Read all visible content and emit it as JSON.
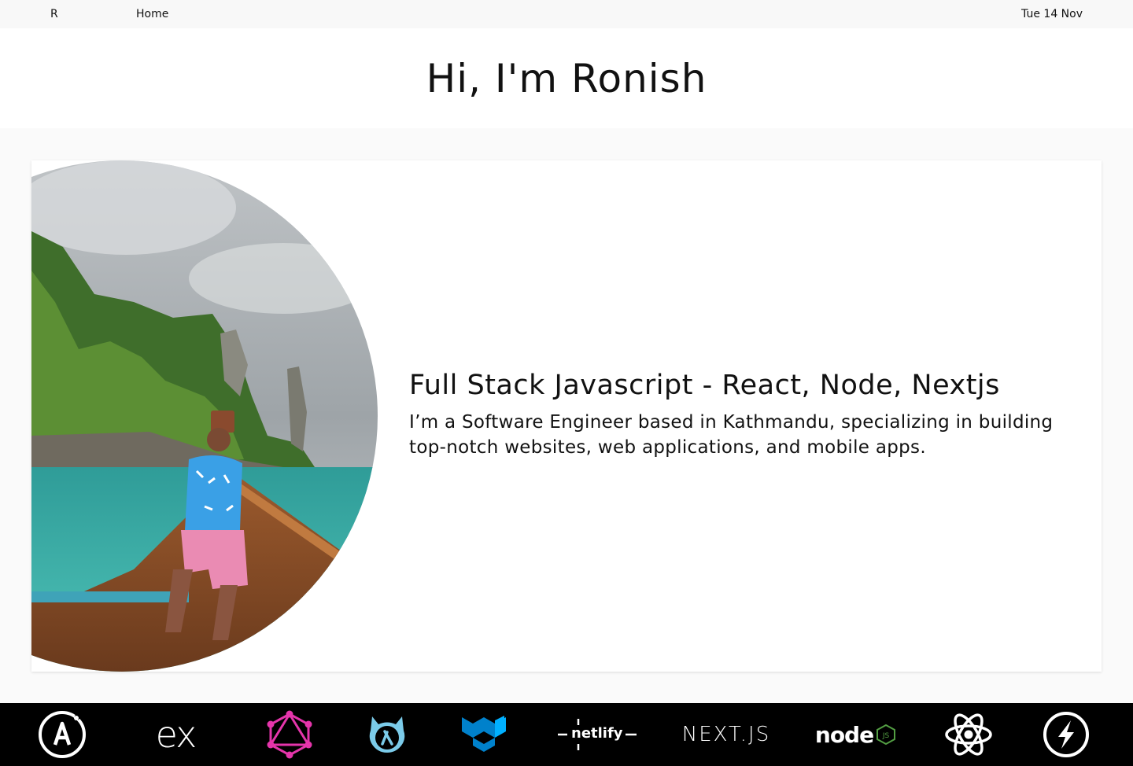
{
  "nav": {
    "logo": "R",
    "home": "Home",
    "date": "Tue 14 Nov"
  },
  "hero": {
    "title": "Hi, I'm Ronish"
  },
  "intro": {
    "headline": "Full Stack Javascript - React, Node, Nextjs",
    "description": "I’m a Software Engineer based in Kathmandu, specializing in building top-notch websites, web applications, and mobile apps."
  },
  "tech_stack": [
    {
      "name": "apollo-icon"
    },
    {
      "name": "express-icon",
      "label": "ex"
    },
    {
      "name": "graphql-icon"
    },
    {
      "name": "hasura-icon"
    },
    {
      "name": "material-ui-icon"
    },
    {
      "name": "netlify-icon",
      "label": "netlify"
    },
    {
      "name": "nextjs-icon",
      "label": "NEXT.JS"
    },
    {
      "name": "nodejs-icon",
      "label": "node"
    },
    {
      "name": "react-icon"
    },
    {
      "name": "serverless-icon"
    }
  ],
  "colors": {
    "graphql": "#e535ab",
    "hasura": "#7bcbe9",
    "material_ui": "#0081cb",
    "node_green": "#539e43"
  }
}
